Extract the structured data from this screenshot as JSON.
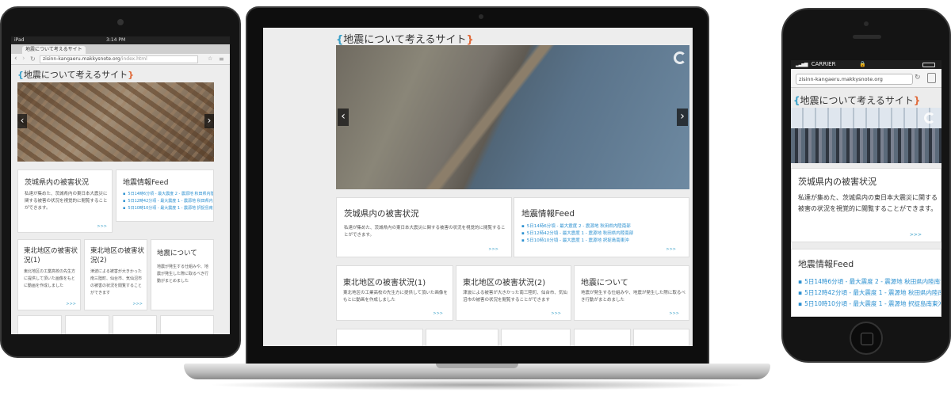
{
  "site": {
    "title": "地震について考えるサイト",
    "bracket_left": "{",
    "bracket_right": "}"
  },
  "ipad": {
    "status": {
      "carrier": "iPad",
      "time": "3:14 PM"
    },
    "tab_title": "地震について考えるサイト",
    "url_host": "zisinn-kangaeru.makkysnote.org",
    "url_path": "/index.html"
  },
  "laptop": {},
  "iphone": {
    "status": {
      "carrier": "CARRIER"
    },
    "url": "zisinn-kangaeru.makkysnote.org",
    "reload_icon": "↻"
  },
  "cards": {
    "ibaraki": {
      "title": "茨城県内の被害状況",
      "body": "私達が集めた、茨城県内の東日本大震災に関する被害の状況を視覚的に閲覧することができます。",
      "more": ">>>"
    },
    "feed": {
      "title": "地震情報Feed",
      "items": [
        "5日14時6分頃 - 最大震度 2 - 震源地 秋田県内陸南部",
        "5日12時42分頃 - 最大震度 1 - 震源地 秋田県内陸南部",
        "5日10時10分頃 - 最大震度 1 - 震源地 択捉島南東沖"
      ],
      "more": ">>>"
    },
    "tohoku1": {
      "title": "東北地区の被害状況(1)",
      "body": "東北地区の工業高校の先生方に提供して頂いた画像をもとに動画を作成しました",
      "more": ">>>"
    },
    "tohoku2": {
      "title": "東北地区の被害状況(2)",
      "body": "津波による被害が大きかった南三陸町、仙台市、気仙沼市の被害の状況を閲覧することができます",
      "more": ">>>"
    },
    "about": {
      "title": "地震について",
      "body": "地震が発生する仕組みや、地震が発生した際に取るべき行動がまとめました",
      "more": ">>>"
    }
  },
  "icons": {
    "prev": "‹",
    "next": "›"
  }
}
